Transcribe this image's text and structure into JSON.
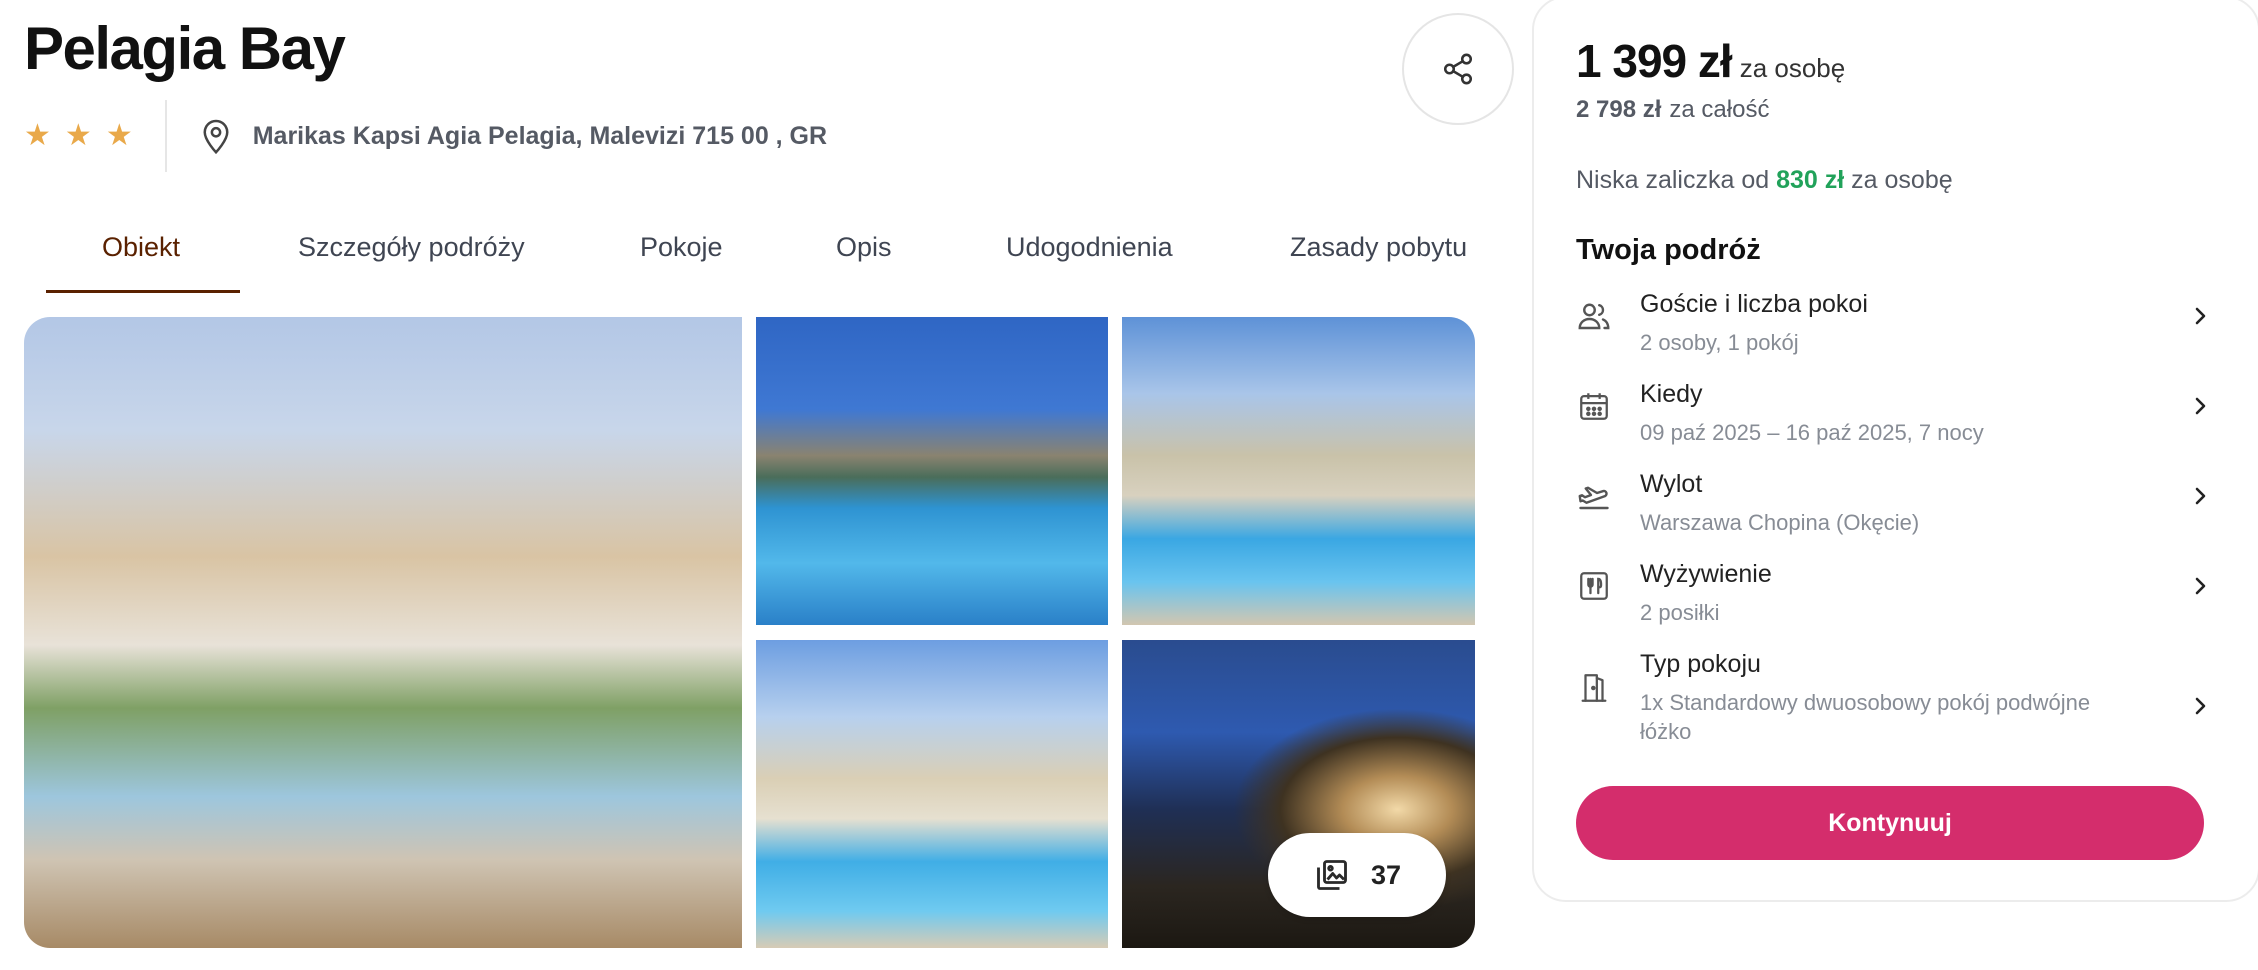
{
  "hotel": {
    "name": "Pelagia Bay",
    "stars": 3,
    "address": "Marikas Kapsi Agia Pelagia, Malevizi 715 00 , GR"
  },
  "tabs": [
    {
      "label": "Obiekt",
      "active": true
    },
    {
      "label": "Szczegóły podróży",
      "active": false
    },
    {
      "label": "Pokoje",
      "active": false
    },
    {
      "label": "Opis",
      "active": false
    },
    {
      "label": "Udogodnienia",
      "active": false
    },
    {
      "label": "Zasady pobytu",
      "active": false
    }
  ],
  "gallery": {
    "photo_count": "37"
  },
  "pricing": {
    "per_person_amount": "1 399 zł",
    "per_person_label": "za osobę",
    "total_amount": "2 798 zł",
    "total_label": "za całość",
    "deposit_prefix": "Niska zaliczka od",
    "deposit_amount": "830 zł",
    "deposit_suffix": "za osobę"
  },
  "trip": {
    "title": "Twoja podróż",
    "items": [
      {
        "icon": "guests-icon",
        "label": "Goście i liczba pokoi",
        "value": "2 osoby, 1 pokój"
      },
      {
        "icon": "calendar-icon",
        "label": "Kiedy",
        "value": "09 paź 2025 – 16 paź 2025, 7 nocy"
      },
      {
        "icon": "plane-departure-icon",
        "label": "Wylot",
        "value": "Warszawa Chopina (Okęcie)"
      },
      {
        "icon": "restaurant-icon",
        "label": "Wyżywienie",
        "value": "2 posiłki"
      },
      {
        "icon": "room-door-icon",
        "label": "Typ pokoju",
        "value": "1x Standardowy dwuosobowy pokój podwójne łóżko"
      }
    ]
  },
  "cta": {
    "continue_label": "Kontynuuj"
  },
  "colors": {
    "accent_brown": "#5a2100",
    "star": "#e9a94a",
    "deposit_green": "#21a25a",
    "cta_pink": "#d42d6c"
  }
}
